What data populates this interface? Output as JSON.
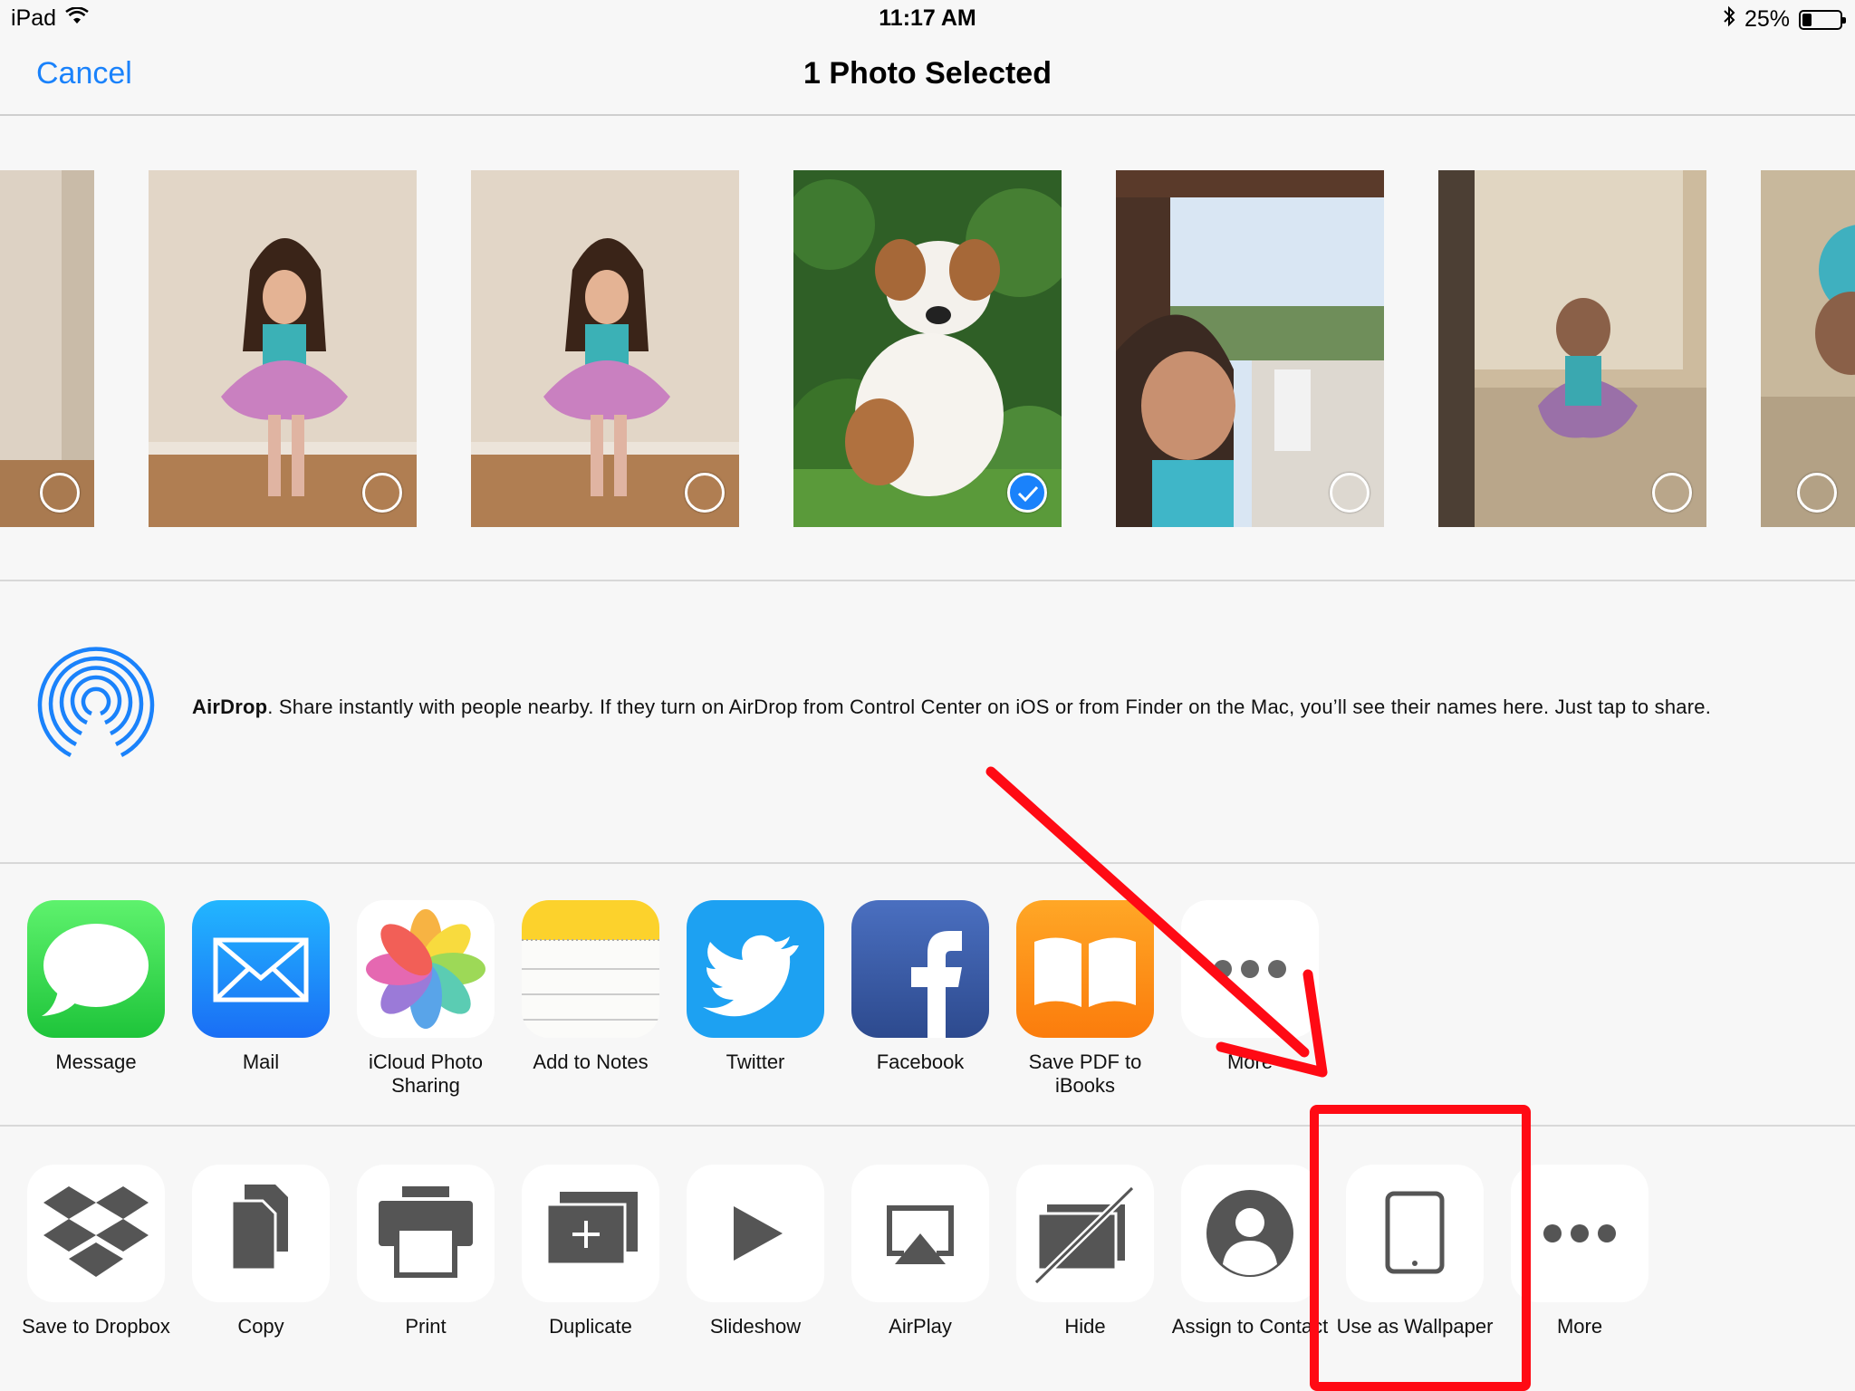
{
  "status_bar": {
    "device": "iPad",
    "time": "11:17 AM",
    "battery": "25%",
    "battery_level": 0.25
  },
  "nav": {
    "cancel": "Cancel",
    "title": "1 Photo Selected"
  },
  "photos": [
    {
      "selected": false
    },
    {
      "selected": false
    },
    {
      "selected": false
    },
    {
      "selected": true
    },
    {
      "selected": false
    },
    {
      "selected": false
    },
    {
      "selected": false
    }
  ],
  "airdrop": {
    "title": "AirDrop",
    "text": ". Share instantly with people nearby. If they turn on AirDrop from Control Center on iOS or from Finder on the Mac, you’ll see their names here. Just tap to share."
  },
  "apps": [
    {
      "label": "Message",
      "icon": "message-icon"
    },
    {
      "label": "Mail",
      "icon": "mail-icon"
    },
    {
      "label": "iCloud Photo Sharing",
      "icon": "photos-icon"
    },
    {
      "label": "Add to Notes",
      "icon": "notes-icon"
    },
    {
      "label": "Twitter",
      "icon": "twitter-icon"
    },
    {
      "label": "Facebook",
      "icon": "facebook-icon"
    },
    {
      "label": "Save PDF to iBooks",
      "icon": "ibooks-icon"
    },
    {
      "label": "More",
      "icon": "more-icon"
    }
  ],
  "actions": [
    {
      "label": "Save to Dropbox",
      "icon": "dropbox-icon"
    },
    {
      "label": "Copy",
      "icon": "copy-icon"
    },
    {
      "label": "Print",
      "icon": "print-icon"
    },
    {
      "label": "Duplicate",
      "icon": "duplicate-icon"
    },
    {
      "label": "Slideshow",
      "icon": "slideshow-icon"
    },
    {
      "label": "AirPlay",
      "icon": "airplay-icon"
    },
    {
      "label": "Hide",
      "icon": "hide-icon"
    },
    {
      "label": "Assign to Contact",
      "icon": "contact-icon"
    },
    {
      "label": "Use as Wallpaper",
      "icon": "wallpaper-icon"
    },
    {
      "label": "More",
      "icon": "more-icon"
    }
  ],
  "colors": {
    "accent": "#1a82fb",
    "annotation": "#ff0a14"
  }
}
